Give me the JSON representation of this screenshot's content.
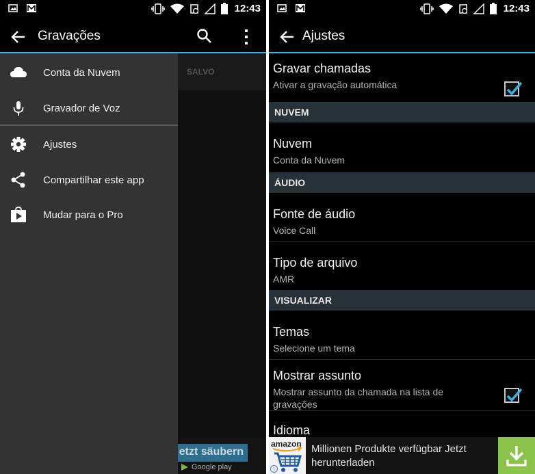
{
  "left": {
    "title": "Gravações",
    "time": "12:43",
    "bg_tab_label": "SALVO",
    "bg_ad_button": "etzt säubern",
    "bg_ad_store": "Google play",
    "drawer": [
      {
        "label": "Conta da Nuvem",
        "icon": "cloud-icon"
      },
      {
        "label": "Gravador de Voz",
        "icon": "microphone-icon"
      },
      {
        "label": "Ajustes",
        "icon": "gear-icon"
      },
      {
        "label": "Compartilhar este app",
        "icon": "share-icon"
      },
      {
        "label": "Mudar para o Pro",
        "icon": "play-store-icon"
      }
    ]
  },
  "right": {
    "title": "Ajustes",
    "time": "12:43",
    "prefs": {
      "record": {
        "title": "Gravar chamadas",
        "summary": "Ativar a gravação automática",
        "checked": true
      },
      "cloud_cat": "NUVEM",
      "cloud": {
        "title": "Nuvem",
        "summary": "Conta da Nuvem"
      },
      "audio_cat": "ÁUDIO",
      "source": {
        "title": "Fonte de áudio",
        "summary": "Voice Call"
      },
      "filetype": {
        "title": "Tipo de arquivo",
        "summary": "AMR"
      },
      "view_cat": "VISUALIZAR",
      "themes": {
        "title": "Temas",
        "summary": "Selecione um tema"
      },
      "subject": {
        "title": "Mostrar assunto",
        "summary": "Mostrar assunto da chamada na lista de gravações",
        "checked": true
      },
      "language": {
        "title": "Idioma"
      }
    },
    "ad": {
      "brand": "amazon",
      "text": "Millionen Produkte verfügbar Jetzt herunterladen",
      "info": "i"
    }
  },
  "colors": {
    "accent": "#33b5e5",
    "drawer_bg": "#333333",
    "category_bg": "#263238",
    "download_green": "#8bc34a"
  }
}
